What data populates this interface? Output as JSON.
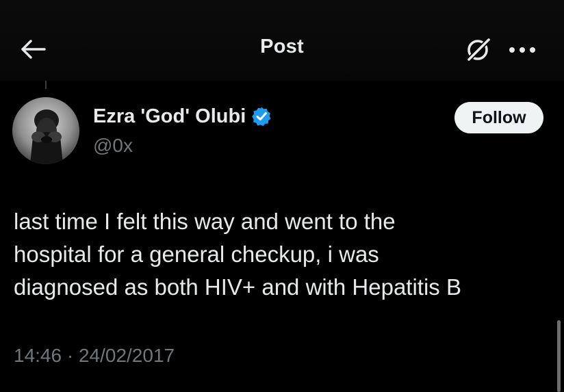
{
  "header": {
    "title": "Post",
    "back_icon": "arrow-left-icon",
    "grok_icon": "grok-icon",
    "more_icon": "more-dots-icon"
  },
  "author": {
    "name": "Ezra 'God' Olubi",
    "handle": "@0x",
    "verified": true,
    "verified_color": "#1d9bf0"
  },
  "follow_button": {
    "label": "Follow"
  },
  "post": {
    "text_lines": [
      "last time I felt this way and went to the",
      "hospital for a general checkup, i was",
      "diagnosed as both HIV+ and with Hepatitis B"
    ],
    "timestamp": "14:46 · 24/02/2017"
  },
  "colors": {
    "background": "#000000",
    "primary_text": "#e7e9ea",
    "secondary_text": "#71767b",
    "button_bg": "#eff3f4",
    "button_text": "#0f1419"
  }
}
